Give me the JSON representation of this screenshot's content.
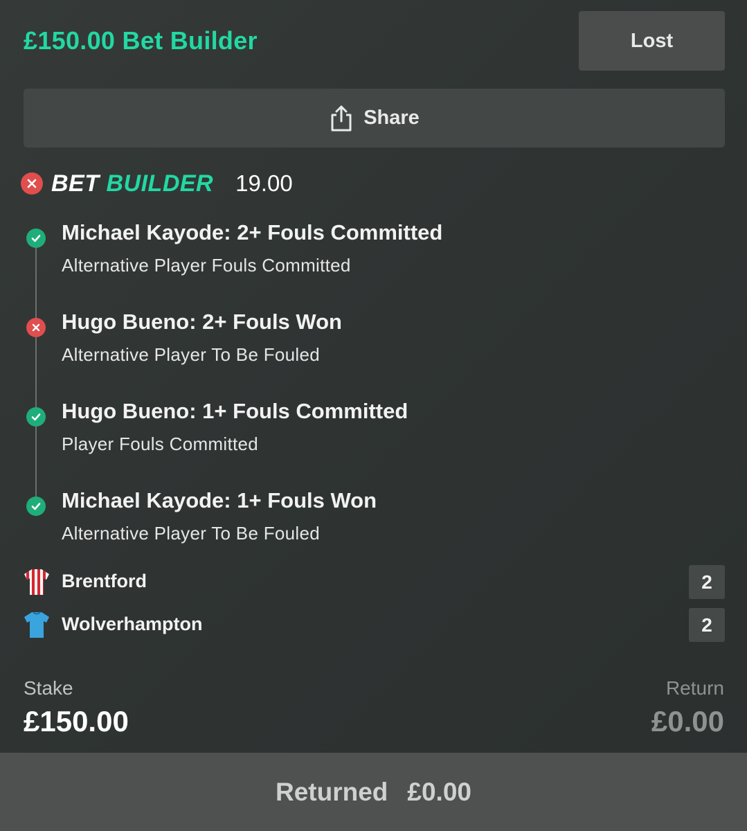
{
  "header": {
    "bet_title": "£150.00 Bet Builder",
    "status_label": "Lost"
  },
  "share": {
    "label": "Share",
    "icon": "share-icon"
  },
  "bet_builder": {
    "word_1": "BET",
    "word_2": "BUILDER",
    "odds": "19.00",
    "status": "lost"
  },
  "selections": [
    {
      "title": "Michael Kayode: 2+ Fouls Committed",
      "market": "Alternative Player Fouls Committed",
      "status": "won"
    },
    {
      "title": "Hugo Bueno: 2+ Fouls Won",
      "market": "Alternative Player To Be Fouled",
      "status": "lost"
    },
    {
      "title": "Hugo Bueno: 1+ Fouls Committed",
      "market": "Player Fouls Committed",
      "status": "won"
    },
    {
      "title": "Michael Kayode: 1+ Fouls Won",
      "market": "Alternative Player To Be Fouled",
      "status": "won"
    }
  ],
  "teams": [
    {
      "name": "Brentford",
      "score": "2",
      "kit_icon": "striped-shirt-icon"
    },
    {
      "name": "Wolverhampton",
      "score": "2",
      "kit_icon": "shirt-icon"
    }
  ],
  "stake": {
    "label": "Stake",
    "value": "£150.00"
  },
  "return": {
    "label": "Return",
    "value": "£0.00"
  },
  "footer": {
    "label": "Returned",
    "value": "£0.00"
  },
  "colors": {
    "accent": "#22d8a3",
    "won": "#1fae7a",
    "lost": "#e04e4e"
  }
}
